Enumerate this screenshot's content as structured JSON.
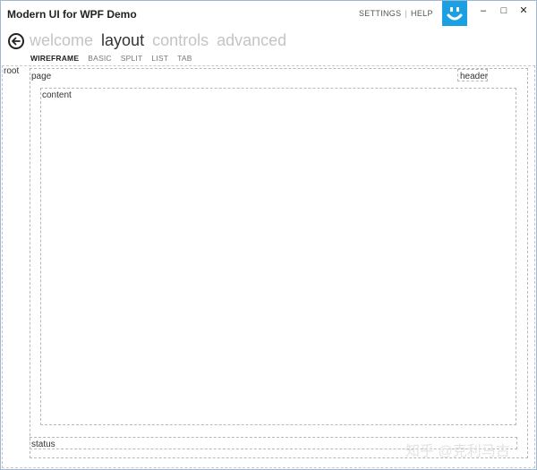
{
  "window": {
    "title": "Modern UI for WPF Demo",
    "accent_color": "#1ba1e2",
    "links": {
      "settings": "SETTINGS",
      "help": "HELP",
      "separator": "|"
    },
    "controls": {
      "minimize": "–",
      "maximize": "□",
      "close": "✕"
    }
  },
  "nav": {
    "back_icon": "arrow-left-icon",
    "main_menu": [
      "welcome",
      "layout",
      "controls",
      "advanced"
    ],
    "active_main": "layout",
    "sub_menu": [
      "WIREFRAME",
      "BASIC",
      "SPLIT",
      "LIST",
      "TAB"
    ],
    "active_sub": "WIREFRAME"
  },
  "wireframe": {
    "root": "root",
    "page": "page",
    "header": "header",
    "content": "content",
    "status": "status"
  },
  "watermark": "知乎 @克利马古"
}
